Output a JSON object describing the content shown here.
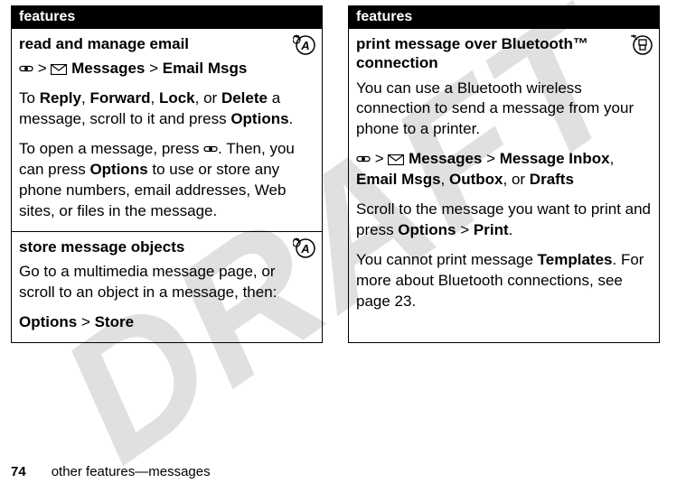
{
  "watermark": "DRAFT",
  "left": {
    "header": "features",
    "read_email": {
      "title": "read and manage email",
      "path_messages": "Messages",
      "path_emailmsgs": "Email Msgs",
      "para1_pre": "To ",
      "reply": "Reply",
      "forward": "Forward",
      "lock": "Lock",
      "delete": "Delete",
      "para1_mid": " a message, scroll to it and press ",
      "options": "Options",
      "para2_pre": "To open a message, press ",
      "para2_mid": ". Then, you can press ",
      "para2_post": " to use or store any phone numbers, email addresses, Web sites, or files in the message."
    },
    "store_obj": {
      "title": "store message objects",
      "para": "Go to a multimedia message page, or scroll to an object in a message, then:",
      "options": "Options",
      "store": "Store"
    }
  },
  "right": {
    "header": "features",
    "print": {
      "title": "print message over Bluetooth™ connection",
      "para1": "You can use a Bluetooth wireless connection to send a message from your phone to a printer.",
      "messages": "Messages",
      "inbox": "Message Inbox",
      "emailmsgs": "Email Msgs",
      "outbox": "Outbox",
      "drafts": "Drafts",
      "para3_pre": "Scroll to the message you want to print and press ",
      "options": "Options",
      "print_label": "Print",
      "para4_pre": "You cannot print message ",
      "templates": "Templates",
      "para4_post": ". For more about Bluetooth connections, see page 23."
    }
  },
  "footer": {
    "page": "74",
    "text": "other features—messages"
  }
}
